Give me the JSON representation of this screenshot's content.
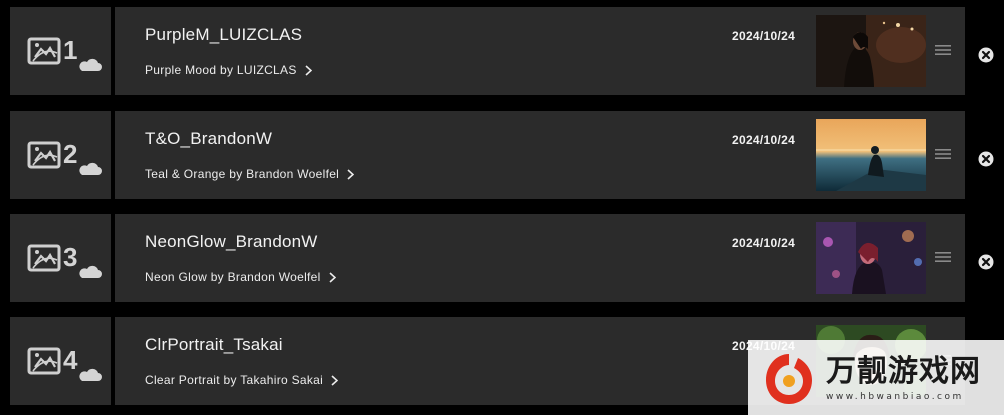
{
  "presets": [
    {
      "slot": "1",
      "name": "PurpleM_LUIZCLAS",
      "description": "Purple Mood by LUIZCLAS",
      "date": "2024/10/24",
      "thumbnail": "portrait-purple-night"
    },
    {
      "slot": "2",
      "name": "T&O_BrandonW",
      "description": "Teal & Orange by Brandon Woelfel",
      "date": "2024/10/24",
      "thumbnail": "sunset-lake-figure"
    },
    {
      "slot": "3",
      "name": "NeonGlow_BrandonW",
      "description": "Neon Glow by Brandon Woelfel",
      "date": "2024/10/24",
      "thumbnail": "neon-street-portrait"
    },
    {
      "slot": "4",
      "name": "ClrPortrait_Tsakai",
      "description": "Clear Portrait by Takahiro Sakai",
      "date": "2024/10/24",
      "thumbnail": "green-foliage-portrait"
    }
  ],
  "watermark": {
    "title": "万靓游戏网",
    "url": "www.hbwanbiao.com"
  },
  "colors": {
    "background": "#000000",
    "card": "#2b2b2b",
    "text": "#f2f2f2",
    "close_icon": "#e6e6e6"
  }
}
